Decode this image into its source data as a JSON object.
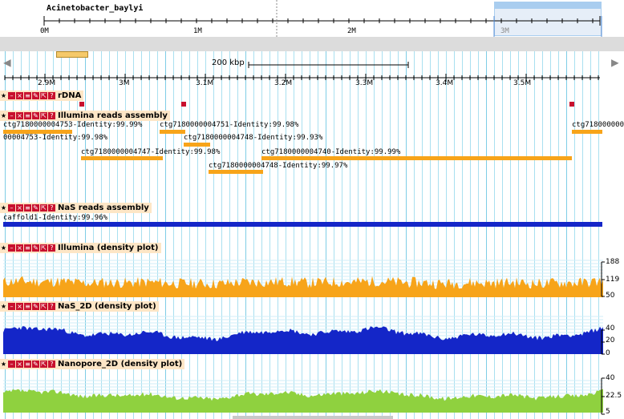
{
  "overview": {
    "title": "Acinetobacter_baylyi",
    "ticks": [
      "0M",
      "1M",
      "2M",
      "3M"
    ],
    "viewport_color": "#a9cdef"
  },
  "nav": {
    "left_arrow": "◀",
    "right_arrow": "▶",
    "scale_label": "200 kbp"
  },
  "ruler": {
    "ticks": [
      "2.9M",
      "3M",
      "3.1M",
      "3.2M",
      "3.3M",
      "3.4M",
      "3.5M"
    ]
  },
  "tracks": {
    "rdna": {
      "name": "rDNA"
    },
    "illumina_assembly": {
      "name": "Illumina reads assembly",
      "features": [
        "ctg7180000004753-Identity:99.99%",
        "ctg7180000004751-Identity:99.98%",
        "ctg718000000",
        "00004753-Identity:99.98%",
        "ctg7180000004748-Identity:99.93%",
        "ctg7180000004747-Identity:99.98%",
        "ctg7180000004740-Identity:99.99%",
        "ctg7180000004748-Identity:99.97%"
      ]
    },
    "nas_assembly": {
      "name": "NaS reads assembly",
      "features": [
        "caffold1-Identity:99.96%"
      ]
    },
    "illumina_density": {
      "name": "Illumina (density plot)",
      "axis": [
        "188",
        "119",
        "50"
      ],
      "color": "#f7a41a"
    },
    "nas_density": {
      "name": "NaS_2D (density plot)",
      "axis": [
        "40",
        "20",
        "0"
      ],
      "color": "#1426c8"
    },
    "nanopore_density": {
      "name": "Nanopore_2D (density plot)",
      "axis": [
        "40",
        "22.5",
        "5"
      ],
      "color": "#8fd13f"
    }
  }
}
